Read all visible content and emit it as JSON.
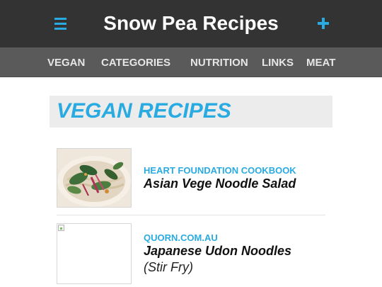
{
  "header": {
    "title": "Snow Pea Recipes",
    "menu_icon": "hamburger-menu-icon",
    "add_icon": "plus-icon",
    "accent_color": "#29abe2",
    "background_color": "#333333"
  },
  "nav": {
    "items": [
      {
        "label": "VEGAN"
      },
      {
        "label": "CATEGORIES"
      },
      {
        "label": "NUTRITION"
      },
      {
        "label": "LINKS"
      },
      {
        "label": "MEAT"
      }
    ],
    "background_color": "#5a5a5a"
  },
  "section": {
    "title": "VEGAN RECIPES"
  },
  "recipes": [
    {
      "source": "HEART FOUNDATION COOKBOOK",
      "name": "Asian Vege Noodle Salad",
      "subtitle": "",
      "image": "noodle-salad-photo"
    },
    {
      "source": "QUORN.COM.AU",
      "name": "Japanese Udon Noodles",
      "subtitle": "(Stir Fry)",
      "image": "broken-image-icon"
    }
  ]
}
